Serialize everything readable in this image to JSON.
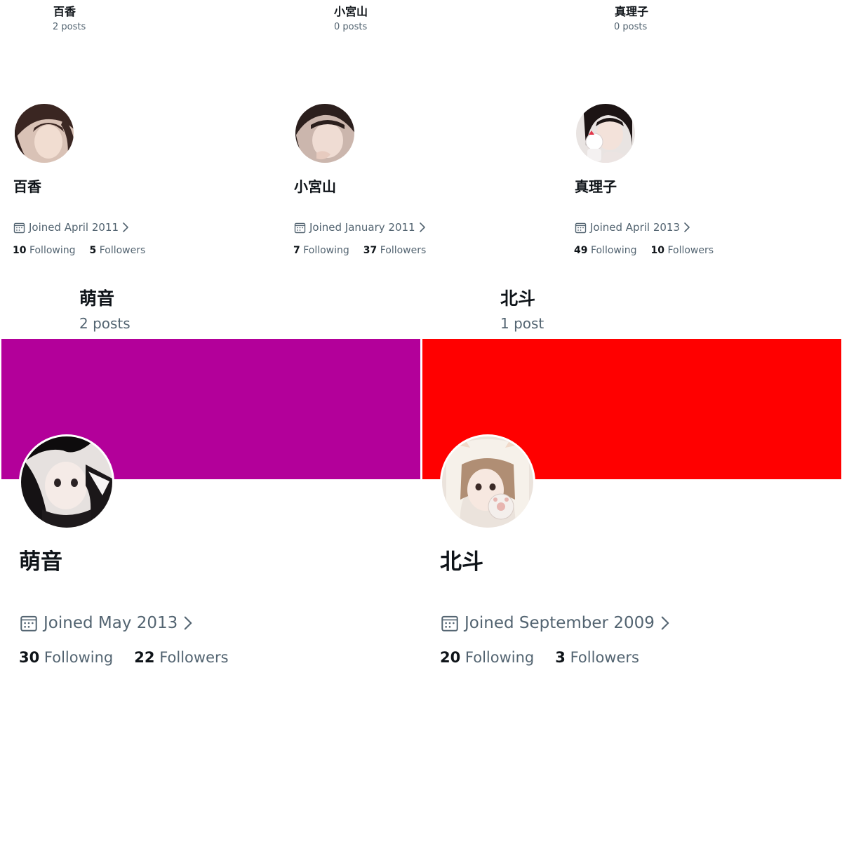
{
  "panels_top": [
    {
      "header_name": "百香",
      "header_posts": "2 posts",
      "display_name": "百香",
      "joined": "Joined April 2011",
      "following_count": "10",
      "following_label": "Following",
      "followers_count": "5",
      "followers_label": "Followers"
    },
    {
      "header_name": "小宮山",
      "header_posts": "0 posts",
      "display_name": "小宮山",
      "joined": "Joined January 2011",
      "following_count": "7",
      "following_label": "Following",
      "followers_count": "37",
      "followers_label": "Followers"
    },
    {
      "header_name": "真理子",
      "header_posts": "0 posts",
      "display_name": "真理子",
      "joined": "Joined April 2013",
      "following_count": "49",
      "following_label": "Following",
      "followers_count": "10",
      "followers_label": "Followers"
    }
  ],
  "panels_bottom": [
    {
      "header_name": "萌音",
      "header_posts": "2 posts",
      "display_name": "萌音",
      "joined": "Joined May 2013",
      "following_count": "30",
      "following_label": "Following",
      "followers_count": "22",
      "followers_label": "Followers",
      "banner_color": "#b3009a"
    },
    {
      "header_name": "北斗",
      "header_posts": "1 post",
      "display_name": "北斗",
      "joined": "Joined September 2009",
      "following_count": "20",
      "following_label": "Following",
      "followers_count": "3",
      "followers_label": "Followers",
      "banner_color": "#ff0000"
    }
  ],
  "icons": {
    "calendar": "calendar-icon",
    "chevron": "chevron-right-icon",
    "avatar": "avatar-photo"
  },
  "colors": {
    "text_primary": "#0f1419",
    "text_secondary": "#536471"
  }
}
